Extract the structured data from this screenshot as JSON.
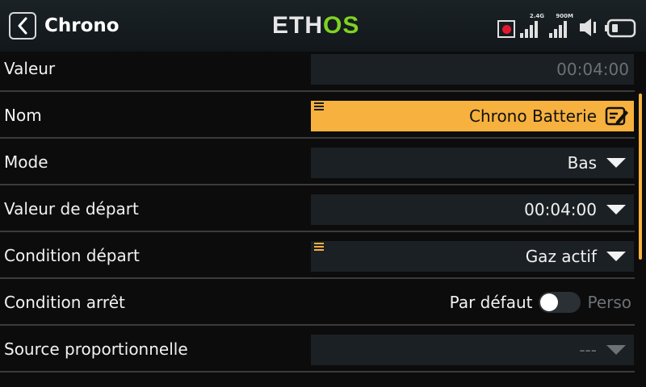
{
  "header": {
    "title": "Chrono",
    "logo_part1": "ETH",
    "logo_part2": "OS",
    "signal_24": "2.4G",
    "signal_900": "900M"
  },
  "rows": [
    {
      "label": "Valeur",
      "value": "00:04:00"
    },
    {
      "label": "Nom",
      "value": "Chrono Batterie"
    },
    {
      "label": "Mode",
      "value": "Bas"
    },
    {
      "label": "Valeur de départ",
      "value": "00:04:00"
    },
    {
      "label": "Condition départ",
      "value": "Gaz actif"
    },
    {
      "label": "Condition arrêt",
      "option_left": "Par défaut",
      "option_right": "Perso"
    },
    {
      "label": "Source proportionnelle",
      "value": "---"
    }
  ],
  "colors": {
    "accent": "#f7b13e",
    "logo_green": "#7ed321",
    "field_bg": "#1a2024",
    "record": "#e2192c"
  }
}
